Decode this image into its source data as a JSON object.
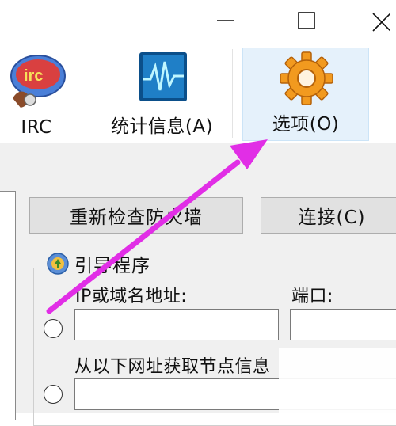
{
  "window": {
    "controls": {
      "minimize": "—",
      "maximize": "□",
      "close": "✕"
    }
  },
  "toolbar": {
    "items": [
      {
        "label": "IRC",
        "icon": "irc-icon"
      },
      {
        "label": "统计信息(A)",
        "icon": "statistics-icon"
      },
      {
        "label": "选项(O)",
        "icon": "options-gear-icon",
        "highlighted": true
      }
    ]
  },
  "buttons": {
    "recheck_firewall": "重新检查防火墙",
    "connect": "连接(C)"
  },
  "bootstrap": {
    "group_title": "引导程序",
    "ip_label": "IP或域名地址:",
    "port_label": "端口:",
    "url_label": "从以下网址获取节点信息",
    "ip_value": "",
    "port_value": "",
    "url_value": ""
  },
  "annotation": {
    "arrow_color": "#e12ee6"
  },
  "colors": {
    "toolbar_highlight": "#e5f1fb",
    "dialog_bg": "#f0f0f0"
  }
}
